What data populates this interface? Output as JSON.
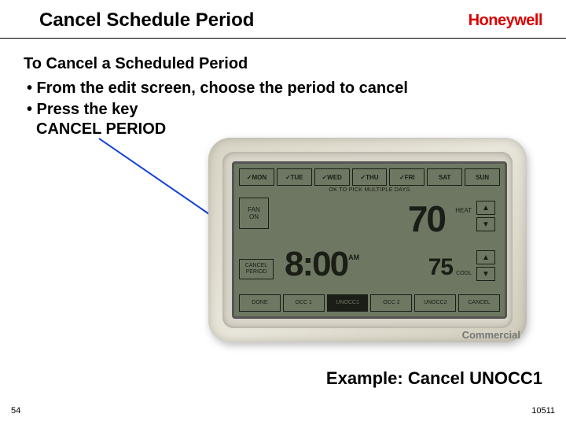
{
  "header": {
    "title": "Cancel Schedule Period",
    "brand": "Honeywell"
  },
  "content": {
    "subheading": "To Cancel a Scheduled Period",
    "bullet1": "• From the edit screen, choose the period to cancel",
    "bullet2": "• Press the key",
    "bullet2_line2": "CANCEL PERIOD"
  },
  "thermostat": {
    "days": [
      "✓MON",
      "✓TUE",
      "✓WED",
      "✓THU",
      "✓FRI",
      "SAT",
      "SUN"
    ],
    "multi_note": "OK TO PICK MULTIPLE DAYS",
    "fan": {
      "label": "FAN",
      "value": "ON"
    },
    "cancel_period": {
      "line1": "CANCEL",
      "line2": "PERIOD"
    },
    "time": "8:00",
    "ampm": "AM",
    "setpoint_heat": "70",
    "heat_label": "HEAT",
    "setpoint_cool": "75",
    "cool_label": "COOL",
    "arrow_up": "▲",
    "arrow_down": "▼",
    "bottom_buttons": [
      "DONE",
      "OCC 1",
      "UNOCC1",
      "OCC 2",
      "UNOCC2",
      "CANCEL"
    ],
    "selected_bottom_index": 2,
    "commercial_label": "Commercial"
  },
  "example": "Example:  Cancel UNOCC1",
  "footer": {
    "page": "54",
    "doc_id": "10511"
  }
}
